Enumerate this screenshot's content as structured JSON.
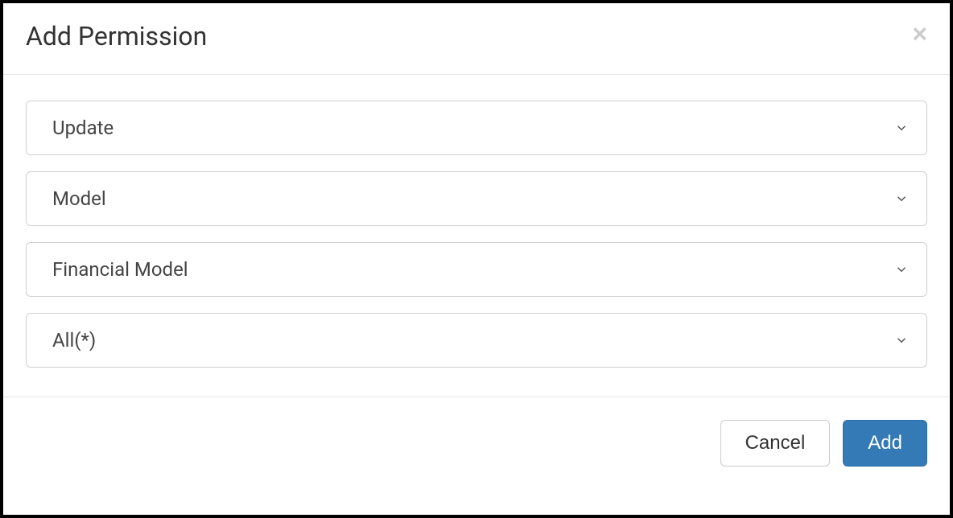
{
  "modal": {
    "title": "Add Permission",
    "dropdowns": [
      {
        "value": "Update"
      },
      {
        "value": "Model"
      },
      {
        "value": "Financial Model"
      },
      {
        "value": "All(*)"
      }
    ],
    "buttons": {
      "cancel": "Cancel",
      "add": "Add"
    }
  }
}
